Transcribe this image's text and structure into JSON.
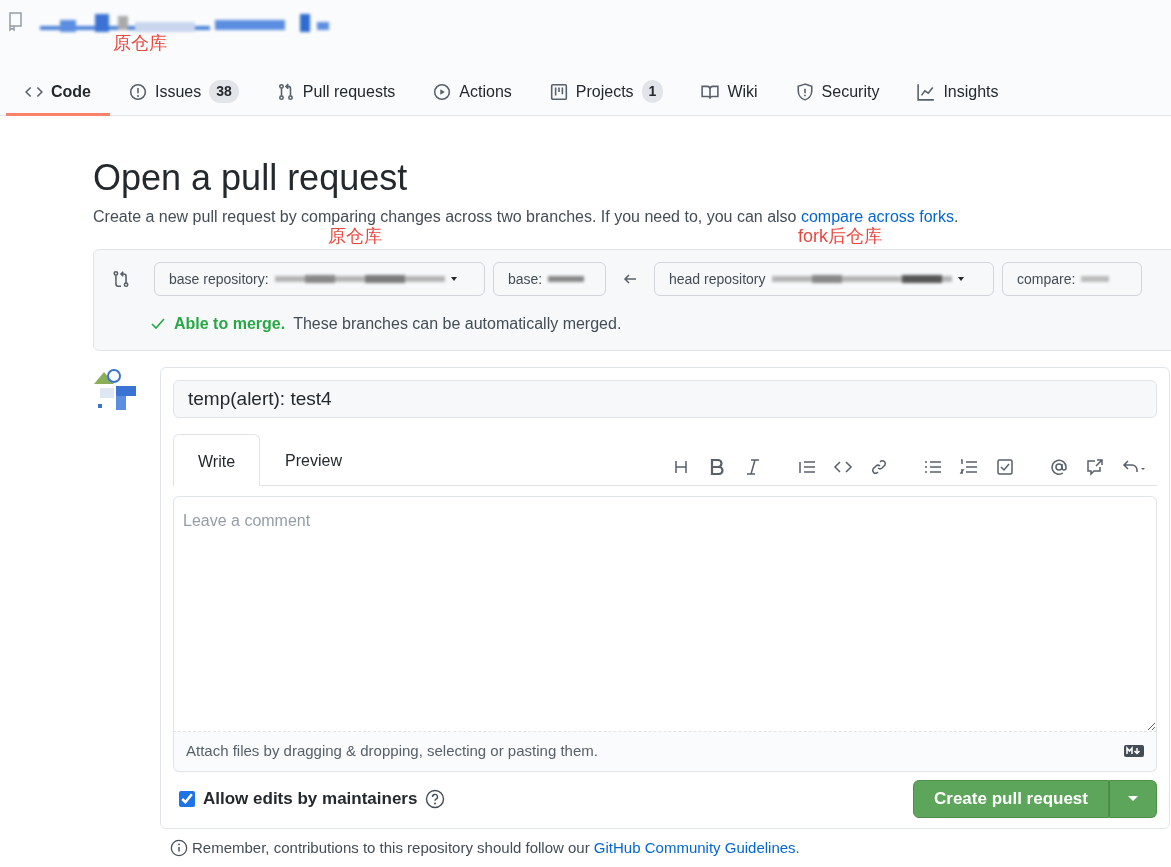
{
  "repo": {
    "annotation": "原仓库"
  },
  "tabs": [
    {
      "label": "Code",
      "selected": true
    },
    {
      "label": "Issues",
      "counter": "38",
      "selected": false
    },
    {
      "label": "Pull requests",
      "selected": false
    },
    {
      "label": "Actions",
      "selected": false
    },
    {
      "label": "Projects",
      "counter": "1",
      "selected": false
    },
    {
      "label": "Wiki",
      "selected": false
    },
    {
      "label": "Security",
      "selected": false
    },
    {
      "label": "Insights",
      "selected": false
    }
  ],
  "heading": "Open a pull request",
  "subtitle": {
    "text": "Create a new pull request by comparing changes across two branches. If you need to, you can also ",
    "link": "compare across forks",
    "end": "."
  },
  "annotations": [
    "原仓库",
    "fork后仓库"
  ],
  "compare": {
    "base_repository": "base repository:",
    "base": "base:",
    "head_repository": "head repository",
    "compare": "compare:",
    "merge_status": "Able to merge.",
    "merge_message": "These branches can be automatically merged."
  },
  "form": {
    "title_value": "temp(alert): test4",
    "tabs": [
      {
        "label": "Write",
        "selected": true
      },
      {
        "label": "Preview",
        "selected": false
      }
    ],
    "placeholder": "Leave a comment",
    "attach": "Attach files by dragging & dropping, selecting or pasting them.",
    "allow_edits": {
      "label": "Allow edits by maintainers",
      "checked": true
    },
    "submit": "Create pull request"
  },
  "footer": {
    "text": "Remember, contributions to this repository should follow our ",
    "link": "GitHub Community Guidelines",
    "end": "."
  }
}
